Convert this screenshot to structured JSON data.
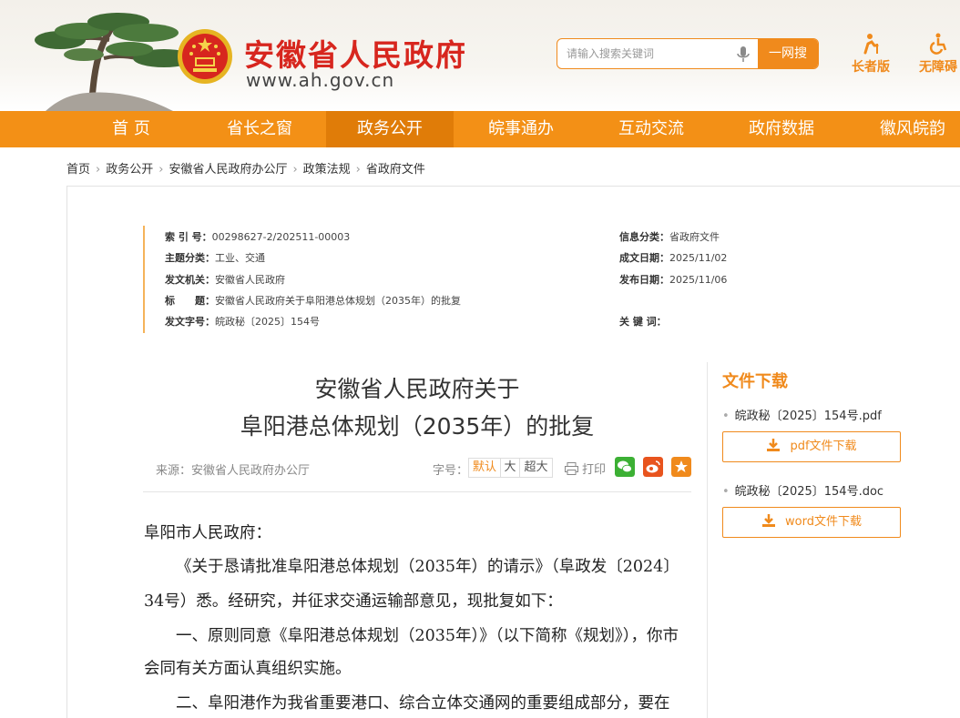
{
  "header": {
    "site_title": "安徽省人民政府",
    "site_url": "www.ah.gov.cn",
    "search_placeholder": "请输入搜索关键词",
    "search_button": "一网搜",
    "elder_label": "长者版",
    "barrier_free_label": "无障碍",
    "accent_color": "#f08a1c",
    "title_color": "#d7261e"
  },
  "nav": {
    "items": [
      "首 页",
      "省长之窗",
      "政务公开",
      "皖事通办",
      "互动交流",
      "政府数据",
      "徽风皖韵"
    ],
    "active_index": 2,
    "bar_color": "#f39016"
  },
  "breadcrumb": [
    "首页",
    "政务公开",
    "安徽省人民政府办公厅",
    "政策法规",
    "省政府文件"
  ],
  "meta": {
    "index_no_label": "索 引 号：",
    "index_no": "00298627-2/202511-00003",
    "topic_label": "主题分类：",
    "topic": "工业、交通",
    "issuer_label": "发文机关：",
    "issuer": "安徽省人民政府",
    "title_label": "标　　题：",
    "title": "安徽省人民政府关于阜阳港总体规划（2035年）的批复",
    "doc_no_label": "发文字号：",
    "doc_no": "皖政秘〔2025〕154号",
    "category_label": "信息分类：",
    "category": "省政府文件",
    "written_label": "成文日期：",
    "written": "2025/11/02",
    "published_label": "发布日期：",
    "published": "2025/11/06",
    "keywords_label": "关 键 词：",
    "keywords": ""
  },
  "doc": {
    "title_line1": "安徽省人民政府关于",
    "title_line2": "阜阳港总体规划（2035年）的批复",
    "source": "来源：安徽省人民政府办公厅",
    "font_size_label": "字号：",
    "font_sizes": [
      "默认",
      "大",
      "超大"
    ],
    "print_label": "打印",
    "salutation": "阜阳市人民政府：",
    "para1_line1": "《关于恳请批准阜阳港总体规划（2035年）的请示》（阜政发〔2024〕",
    "para1_line2": "34号）悉。经研究，并征求交通运输部意见，现批复如下：",
    "para2_line1": "一、原则同意《阜阳港总体规划（2035年）》（以下简称《规划》），你市",
    "para2_line2": "会同有关方面认真组织实施。",
    "para3_line1": "二、阜阳港作为我省重要港口、综合立体交通网的重要组成部分，要在"
  },
  "downloads": {
    "title": "文件下载",
    "files": [
      {
        "name": "皖政秘〔2025〕154号.pdf",
        "button": "pdf文件下载"
      },
      {
        "name": "皖政秘〔2025〕154号.doc",
        "button": "word文件下载"
      }
    ]
  },
  "icons": {
    "mic": "microphone-icon",
    "elder": "elder-person-icon",
    "wheelchair": "wheelchair-icon",
    "print": "printer-icon",
    "wechat": "wechat-icon",
    "weibo": "weibo-icon",
    "favorite": "star-icon",
    "download": "download-icon"
  }
}
